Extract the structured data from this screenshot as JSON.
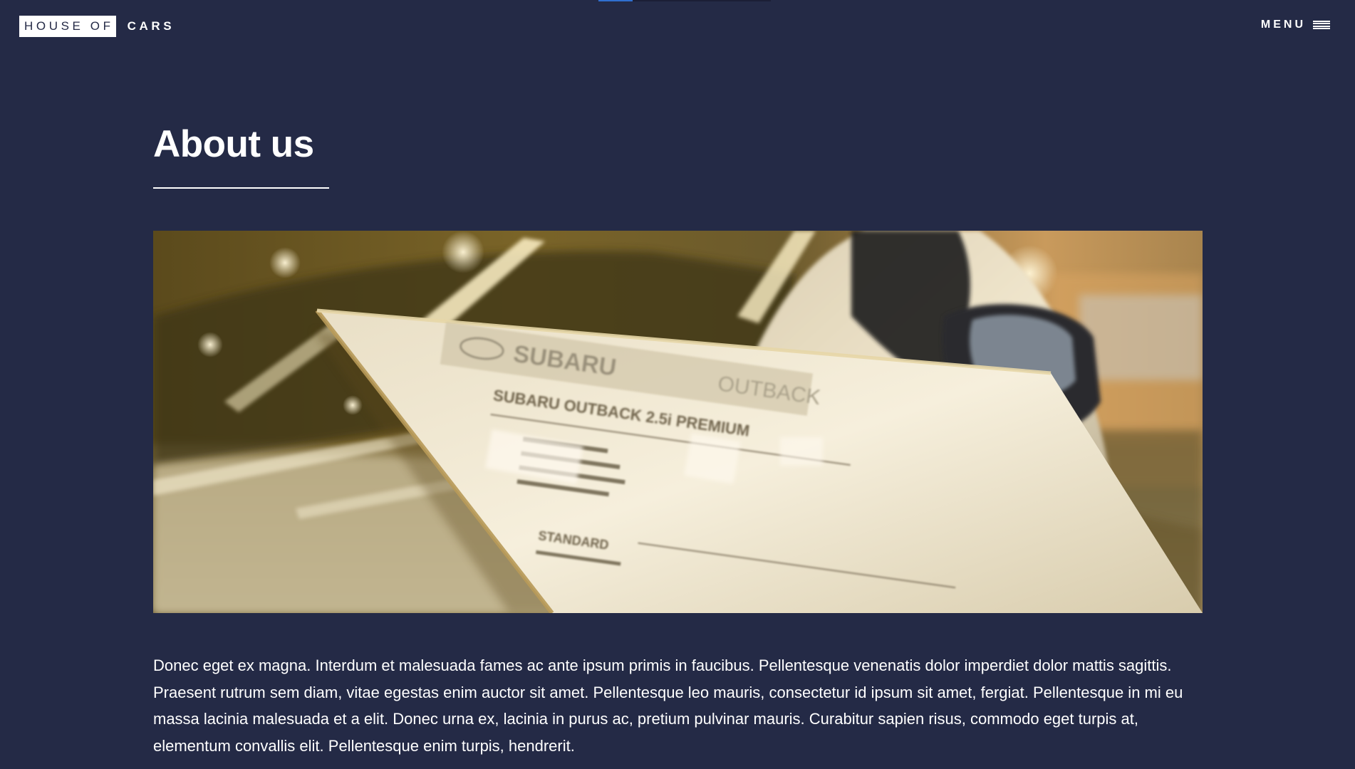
{
  "header": {
    "logo_boxed": "HOUSE OF",
    "logo_plain": "CARS",
    "menu_label": "MENU",
    "menu_icon": "hamburger-icon",
    "progress": 0.2
  },
  "main": {
    "title": "About us",
    "hero_image": {
      "sign_brand": "SUBARU",
      "sign_model": "OUTBACK",
      "sign_heading": "SUBARU OUTBACK 2.5i PREMIUM",
      "sign_section": "STANDARD"
    },
    "paragraph": "Donec eget ex magna. Interdum et malesuada fames ac ante ipsum primis in faucibus. Pellentesque venenatis dolor imperdiet dolor mattis sagittis. Praesent rutrum sem diam, vitae egestas enim auctor sit amet. Pellentesque leo mauris, consectetur id ipsum sit amet, fergiat. Pellentesque in mi eu massa lacinia malesuada et a elit. Donec urna ex, lacinia in purus ac, pretium pulvinar mauris. Curabitur sapien risus, commodo eget turpis at, elementum convallis elit. Pellentesque enim turpis, hendrerit."
  },
  "colors": {
    "background": "#242a46",
    "text": "#ffffff",
    "progress_accent": "#2f6fd0"
  }
}
